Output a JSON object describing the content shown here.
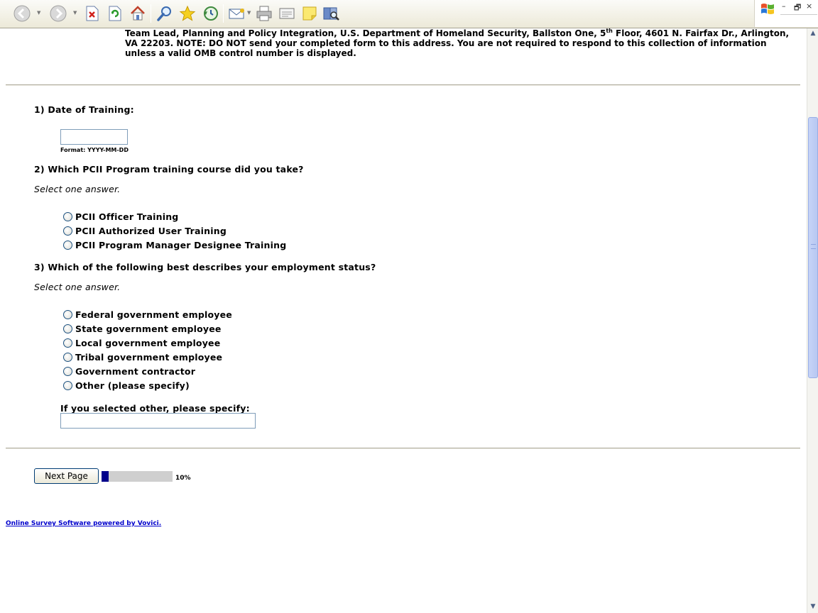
{
  "toolbar": {
    "buttons": [
      {
        "name": "back",
        "icon": "back-arrow-icon"
      },
      {
        "name": "forward",
        "icon": "forward-arrow-icon"
      },
      {
        "name": "stop",
        "icon": "stop-icon"
      },
      {
        "name": "refresh",
        "icon": "refresh-icon"
      },
      {
        "name": "home",
        "icon": "home-icon"
      },
      {
        "name": "search",
        "icon": "search-icon"
      },
      {
        "name": "favorites",
        "icon": "star-icon"
      },
      {
        "name": "history",
        "icon": "history-icon"
      },
      {
        "name": "mail",
        "icon": "mail-icon"
      },
      {
        "name": "print",
        "icon": "printer-icon"
      },
      {
        "name": "edit",
        "icon": "edit-icon"
      },
      {
        "name": "discuss",
        "icon": "note-icon"
      },
      {
        "name": "research",
        "icon": "research-icon"
      }
    ],
    "window_controls": {
      "minimize": "–",
      "restore": "🗗",
      "close": "×"
    }
  },
  "notice": {
    "line1_pre": "Team Lead, Planning and Policy Integration, U.S. Department of Homeland Security, Ballston One, 5",
    "line1_sup": "th",
    "line1_post": " Floor, 4601 N. Fairfax Dr., Arlington, VA 22203. NOTE: DO NOT send your completed form to this address. You are not required to respond to this collection of information unless a valid OMB control number is displayed."
  },
  "q1": {
    "label": "1) Date of Training:",
    "value": "",
    "format_hint": "Format: YYYY-MM-DD"
  },
  "q2": {
    "label": "2) Which PCII Program training course did you take?",
    "hint": "Select one answer.",
    "options": [
      "PCII Officer Training",
      "PCII Authorized User Training",
      "PCII Program Manager Designee Training"
    ]
  },
  "q3": {
    "label": "3) Which of the following best describes your employment status?",
    "hint": "Select one answer.",
    "options": [
      "Federal government employee",
      "State government employee",
      "Local government employee",
      "Tribal government employee",
      "Government contractor",
      "Other (please specify)"
    ],
    "other_label": "If you selected other, please specify:",
    "other_value": ""
  },
  "nav": {
    "next_label": "Next Page",
    "progress_percent": 10,
    "progress_text": "10%"
  },
  "footer": {
    "link_text": "Online Survey Software powered by Vovici."
  },
  "colors": {
    "progress_fill": "#00008b",
    "progress_track": "#cfcfcf",
    "link": "#0000cc"
  }
}
